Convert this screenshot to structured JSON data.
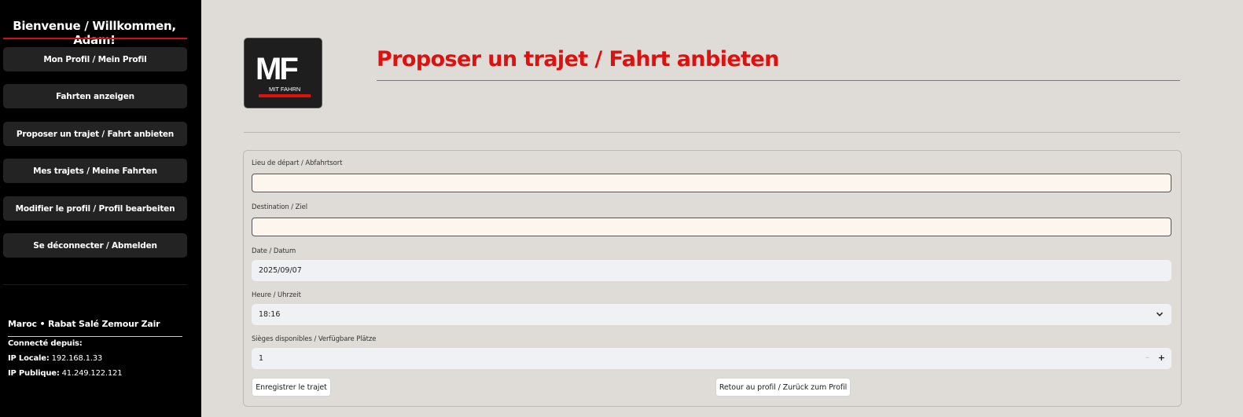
{
  "sidebar": {
    "welcome": "Bienvenue / Willkommen, Adam!",
    "nav": [
      {
        "label": "Mon Profil / Mein Profil"
      },
      {
        "label": "Fahrten anzeigen"
      },
      {
        "label": "Proposer un trajet / Fahrt anbieten"
      },
      {
        "label": "Mes trajets / Meine Fahrten"
      },
      {
        "label": "Modifier le profil / Profil bearbeiten"
      },
      {
        "label": "Se déconnecter / Abmelden"
      }
    ],
    "location": "Maroc • Rabat Salé Zemour Zair",
    "connected_label": "Connecté depuis:",
    "ip_local_label": "IP Locale:",
    "ip_local_value": "192.168.1.33",
    "ip_public_label": "IP Publique:",
    "ip_public_value": "41.249.122.121"
  },
  "logo": {
    "letters": "MF",
    "caption": "MIT FAHRN",
    "accent": "#e0100f"
  },
  "main": {
    "title": "Proposer un trajet / Fahrt anbieten",
    "title_color": "#e0100f"
  },
  "form": {
    "departure_label": "Lieu de départ / Abfahrtsort",
    "departure_value": "",
    "destination_label": "Destination / Ziel",
    "destination_value": "",
    "date_label": "Date / Datum",
    "date_value": "2025/09/07",
    "time_label": "Heure / Uhrzeit",
    "time_value": "18:16",
    "seats_label": "Sièges disponibles / Verfügbare Plätze",
    "seats_value": "1",
    "stepper_minus": "–",
    "stepper_plus": "+",
    "save_label": "Enregistrer le trajet",
    "back_label": "Retour au profil / Zurück zum Profil"
  },
  "icons": {
    "time_dropdown": "chevron-down-icon"
  }
}
